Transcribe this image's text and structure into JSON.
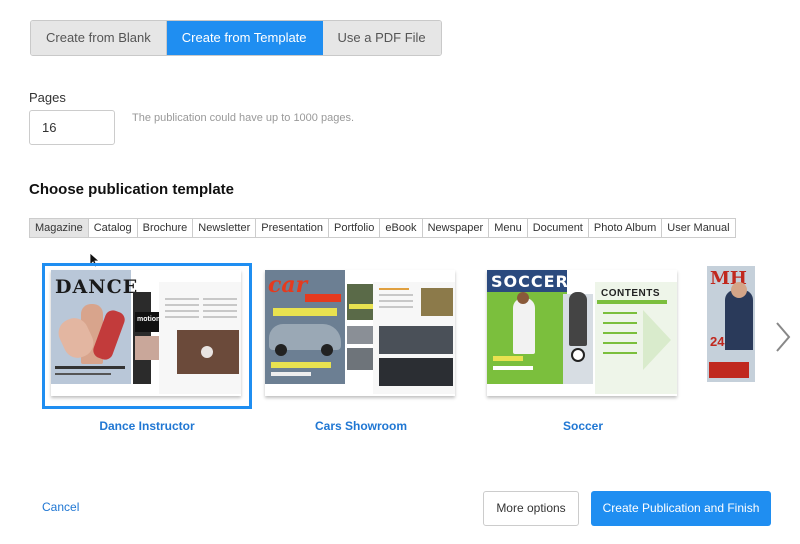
{
  "source_tabs": {
    "items": [
      {
        "label": "Create from Blank",
        "active": false
      },
      {
        "label": "Create from Template",
        "active": true
      },
      {
        "label": "Use a PDF File",
        "active": false
      }
    ]
  },
  "pages": {
    "label": "Pages",
    "value": "16",
    "hint": "The publication could have up to 1000 pages."
  },
  "template_section": {
    "title": "Choose publication template",
    "categories": [
      {
        "label": "Magazine",
        "active": true
      },
      {
        "label": "Catalog",
        "active": false
      },
      {
        "label": "Brochure",
        "active": false
      },
      {
        "label": "Newsletter",
        "active": false
      },
      {
        "label": "Presentation",
        "active": false
      },
      {
        "label": "Portfolio",
        "active": false
      },
      {
        "label": "eBook",
        "active": false
      },
      {
        "label": "Newspaper",
        "active": false
      },
      {
        "label": "Menu",
        "active": false
      },
      {
        "label": "Document",
        "active": false
      },
      {
        "label": "Photo Album",
        "active": false
      },
      {
        "label": "User Manual",
        "active": false
      }
    ],
    "templates": [
      {
        "name": "Dance Instructor",
        "selected": true,
        "cover_text": "DANCE",
        "cover_color": "#b9c7d8",
        "accent": "#1a1a1a"
      },
      {
        "name": "Cars Showroom",
        "selected": false,
        "cover_text": "car",
        "cover_color": "#6c7f93",
        "accent": "#e53a1e"
      },
      {
        "name": "Soccer",
        "selected": false,
        "cover_text": "SOCCER",
        "cover_color": "#7bbf3d",
        "accent": "#2b4a7e"
      },
      {
        "name": "",
        "selected": false,
        "cover_text": "MH",
        "cover_color": "#c5d0da",
        "accent": "#c0281e"
      }
    ]
  },
  "icons": {
    "cursor": "mouse-pointer-icon",
    "next": "chevron-right-icon"
  },
  "footer": {
    "cancel_label": "Cancel",
    "more_options_label": "More options",
    "finish_label": "Create Publication and Finish"
  },
  "colors": {
    "accent": "#1f8ef1",
    "link": "#2077d3"
  }
}
